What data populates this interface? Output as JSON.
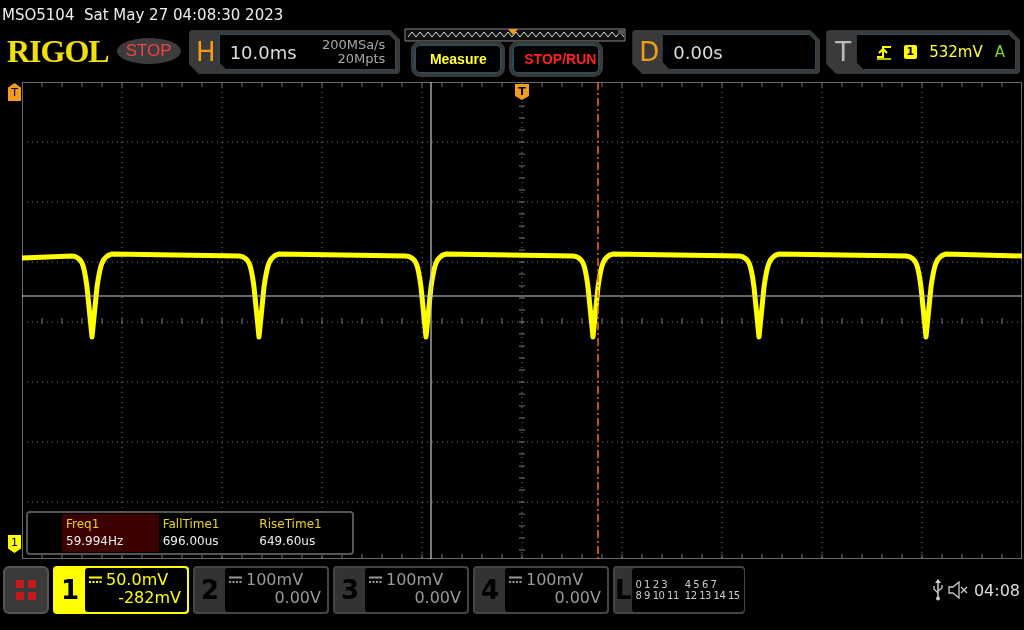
{
  "title": "MSO5104  Sat May 27 04:08:30 2023",
  "logo": "RIGOL",
  "run_status": {
    "label": "STOP",
    "stopped": true
  },
  "horizontal": {
    "letter": "H",
    "scale": "10.0ms",
    "sample_rate": "200MSa/s",
    "memory": "20Mpts"
  },
  "buttons": [
    {
      "label": "Measure",
      "kind": "measure"
    },
    {
      "label": "STOP/RUN",
      "kind": "stoprun"
    }
  ],
  "delay": {
    "letter": "D",
    "value": "0.00s"
  },
  "trigger": {
    "letter": "T",
    "source": "1",
    "level": "532mV",
    "mode": "A"
  },
  "markers": {
    "trigger_position": "T",
    "trigger_level": "T",
    "channel": "1"
  },
  "measurements": [
    {
      "name": "Freq1",
      "value": "59.994Hz",
      "selected": true
    },
    {
      "name": "FallTime1",
      "value": "696.00us",
      "selected": false
    },
    {
      "name": "RiseTime1",
      "value": "649.60us",
      "selected": false
    }
  ],
  "channels": [
    {
      "number": "1",
      "scale": "50.0mV",
      "offset": "-282mV",
      "on": true
    },
    {
      "number": "2",
      "scale": "100mV",
      "offset": "0.00V",
      "on": false
    },
    {
      "number": "3",
      "scale": "100mV",
      "offset": "0.00V",
      "on": false
    },
    {
      "number": "4",
      "scale": "100mV",
      "offset": "0.00V",
      "on": false
    }
  ],
  "logic": {
    "letter": "L",
    "bits": [
      "0 1 2 3",
      "4 5 6 7",
      "8 9 10 11",
      "12 13 14 15"
    ]
  },
  "status_bar": {
    "time": "04:08"
  }
}
